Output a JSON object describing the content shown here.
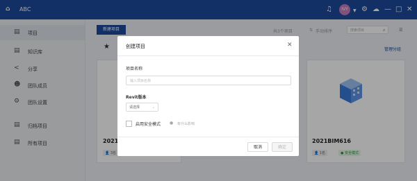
{
  "app": {
    "title": "ABC",
    "logo_icon": "home-icon"
  },
  "titlebar": {
    "avatar_text": "IVY",
    "icons": [
      "bell-icon",
      "settings-icon",
      "cloud-icon",
      "minimize-icon",
      "maximize-icon",
      "close-icon"
    ]
  },
  "sidebar": {
    "items": [
      {
        "label": "项目",
        "icon": "project-icon",
        "active": true
      },
      {
        "label": "知识库",
        "icon": "book-icon"
      },
      {
        "label": "分享",
        "icon": "share-icon"
      },
      {
        "label": "团队成员",
        "icon": "team-icon"
      },
      {
        "label": "团队设置",
        "icon": "gear-icon"
      },
      {
        "label": "归档项目",
        "icon": "archive-icon"
      },
      {
        "label": "所有项目",
        "icon": "folder-icon"
      }
    ]
  },
  "main": {
    "new_project_button": "新建项目",
    "project_count": "共3个项目",
    "sort_label": "手动排序",
    "search_placeholder": "搜索项目",
    "group_link": "管理分组",
    "cards": [
      {
        "title": "2021",
        "members": "3名",
        "badge": ""
      },
      {
        "title": "2021BIM616",
        "members": "1名",
        "badge": "安全模式"
      }
    ]
  },
  "modal": {
    "title": "创建项目",
    "project_name_label": "项目名称",
    "project_name_placeholder": "输入项目名称",
    "revit_label": "Revit版本",
    "revit_select": "请选择",
    "safe_mode_label": "启用安全模式",
    "safe_mode_hint": "有什么影响",
    "cancel_button": "取消",
    "confirm_button": "确定"
  }
}
